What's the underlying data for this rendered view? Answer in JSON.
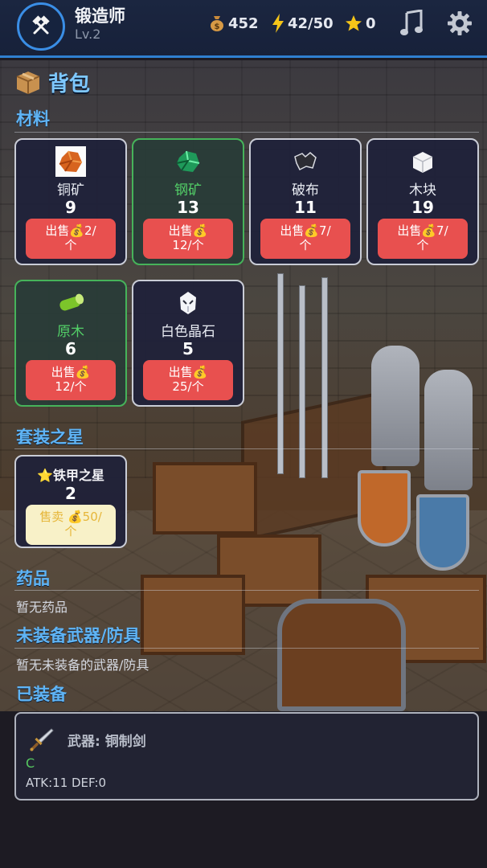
{
  "header": {
    "name": "锻造师",
    "level": "Lv.2",
    "gold": "452",
    "energy": "42/50",
    "stars": "0",
    "icons": [
      "hammers-icon",
      "money-bag-icon",
      "lightning-icon",
      "star-icon",
      "music-note-icon",
      "gear-icon"
    ]
  },
  "page": {
    "title": "背包",
    "title_icon": "box-icon"
  },
  "sections": {
    "materials": "材料",
    "set_stars": "套装之星",
    "potions": "药品",
    "unequipped": "未装备武器/防具",
    "equipped": "已装备"
  },
  "materials": [
    {
      "name": "铜矿",
      "qty": "9",
      "sell_line1": "出售💰2/",
      "sell_line2": "个",
      "icon": "copper-ore-icon",
      "highlight": false
    },
    {
      "name": "钢矿",
      "qty": "13",
      "sell_line1": "出售💰",
      "sell_line2": "12/个",
      "icon": "steel-ore-icon",
      "highlight": true
    },
    {
      "name": "破布",
      "qty": "11",
      "sell_line1": "出售💰7/",
      "sell_line2": "个",
      "icon": "rag-icon",
      "highlight": false
    },
    {
      "name": "木块",
      "qty": "19",
      "sell_line1": "出售💰7/",
      "sell_line2": "个",
      "icon": "wood-block-icon",
      "highlight": false
    },
    {
      "name": "原木",
      "qty": "6",
      "sell_line1": "出售💰",
      "sell_line2": "12/个",
      "icon": "log-icon",
      "highlight": true
    },
    {
      "name": "白色晶石",
      "qty": "5",
      "sell_line1": "出售💰",
      "sell_line2": "25/个",
      "icon": "white-crystal-icon",
      "highlight": false
    }
  ],
  "set_star": {
    "name": "⭐铁甲之星",
    "qty": "2",
    "sell_line1": "售卖 💰50/",
    "sell_line2": "个"
  },
  "potions_empty": "暂无药品",
  "unequipped_empty": "暂无未装备的武器/防具",
  "equipped": {
    "slot_name": "武器: 铜制剑",
    "grade": "C",
    "stats": "ATK:11 DEF:0",
    "icon": "sword-icon"
  },
  "colors": {
    "accent_blue": "#5fb4f5",
    "sell_red": "#e8504f",
    "rare_green": "#46b35a",
    "set_sell_bg": "#f8f1c8"
  }
}
